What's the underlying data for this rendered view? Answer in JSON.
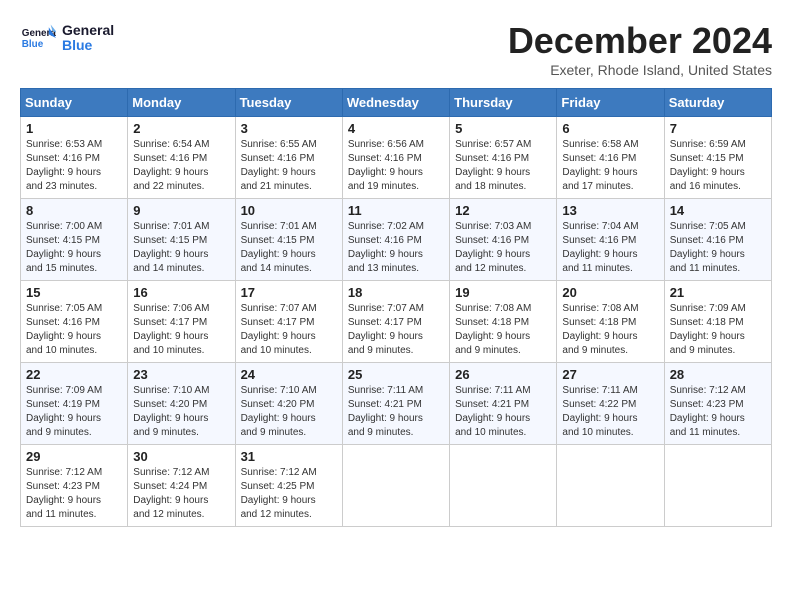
{
  "logo": {
    "line1": "General",
    "line2": "Blue"
  },
  "title": "December 2024",
  "location": "Exeter, Rhode Island, United States",
  "days_of_week": [
    "Sunday",
    "Monday",
    "Tuesday",
    "Wednesday",
    "Thursday",
    "Friday",
    "Saturday"
  ],
  "weeks": [
    [
      {
        "day": "1",
        "info": "Sunrise: 6:53 AM\nSunset: 4:16 PM\nDaylight: 9 hours\nand 23 minutes."
      },
      {
        "day": "2",
        "info": "Sunrise: 6:54 AM\nSunset: 4:16 PM\nDaylight: 9 hours\nand 22 minutes."
      },
      {
        "day": "3",
        "info": "Sunrise: 6:55 AM\nSunset: 4:16 PM\nDaylight: 9 hours\nand 21 minutes."
      },
      {
        "day": "4",
        "info": "Sunrise: 6:56 AM\nSunset: 4:16 PM\nDaylight: 9 hours\nand 19 minutes."
      },
      {
        "day": "5",
        "info": "Sunrise: 6:57 AM\nSunset: 4:16 PM\nDaylight: 9 hours\nand 18 minutes."
      },
      {
        "day": "6",
        "info": "Sunrise: 6:58 AM\nSunset: 4:16 PM\nDaylight: 9 hours\nand 17 minutes."
      },
      {
        "day": "7",
        "info": "Sunrise: 6:59 AM\nSunset: 4:15 PM\nDaylight: 9 hours\nand 16 minutes."
      }
    ],
    [
      {
        "day": "8",
        "info": "Sunrise: 7:00 AM\nSunset: 4:15 PM\nDaylight: 9 hours\nand 15 minutes."
      },
      {
        "day": "9",
        "info": "Sunrise: 7:01 AM\nSunset: 4:15 PM\nDaylight: 9 hours\nand 14 minutes."
      },
      {
        "day": "10",
        "info": "Sunrise: 7:01 AM\nSunset: 4:15 PM\nDaylight: 9 hours\nand 14 minutes."
      },
      {
        "day": "11",
        "info": "Sunrise: 7:02 AM\nSunset: 4:16 PM\nDaylight: 9 hours\nand 13 minutes."
      },
      {
        "day": "12",
        "info": "Sunrise: 7:03 AM\nSunset: 4:16 PM\nDaylight: 9 hours\nand 12 minutes."
      },
      {
        "day": "13",
        "info": "Sunrise: 7:04 AM\nSunset: 4:16 PM\nDaylight: 9 hours\nand 11 minutes."
      },
      {
        "day": "14",
        "info": "Sunrise: 7:05 AM\nSunset: 4:16 PM\nDaylight: 9 hours\nand 11 minutes."
      }
    ],
    [
      {
        "day": "15",
        "info": "Sunrise: 7:05 AM\nSunset: 4:16 PM\nDaylight: 9 hours\nand 10 minutes."
      },
      {
        "day": "16",
        "info": "Sunrise: 7:06 AM\nSunset: 4:17 PM\nDaylight: 9 hours\nand 10 minutes."
      },
      {
        "day": "17",
        "info": "Sunrise: 7:07 AM\nSunset: 4:17 PM\nDaylight: 9 hours\nand 10 minutes."
      },
      {
        "day": "18",
        "info": "Sunrise: 7:07 AM\nSunset: 4:17 PM\nDaylight: 9 hours\nand 9 minutes."
      },
      {
        "day": "19",
        "info": "Sunrise: 7:08 AM\nSunset: 4:18 PM\nDaylight: 9 hours\nand 9 minutes."
      },
      {
        "day": "20",
        "info": "Sunrise: 7:08 AM\nSunset: 4:18 PM\nDaylight: 9 hours\nand 9 minutes."
      },
      {
        "day": "21",
        "info": "Sunrise: 7:09 AM\nSunset: 4:18 PM\nDaylight: 9 hours\nand 9 minutes."
      }
    ],
    [
      {
        "day": "22",
        "info": "Sunrise: 7:09 AM\nSunset: 4:19 PM\nDaylight: 9 hours\nand 9 minutes."
      },
      {
        "day": "23",
        "info": "Sunrise: 7:10 AM\nSunset: 4:20 PM\nDaylight: 9 hours\nand 9 minutes."
      },
      {
        "day": "24",
        "info": "Sunrise: 7:10 AM\nSunset: 4:20 PM\nDaylight: 9 hours\nand 9 minutes."
      },
      {
        "day": "25",
        "info": "Sunrise: 7:11 AM\nSunset: 4:21 PM\nDaylight: 9 hours\nand 9 minutes."
      },
      {
        "day": "26",
        "info": "Sunrise: 7:11 AM\nSunset: 4:21 PM\nDaylight: 9 hours\nand 10 minutes."
      },
      {
        "day": "27",
        "info": "Sunrise: 7:11 AM\nSunset: 4:22 PM\nDaylight: 9 hours\nand 10 minutes."
      },
      {
        "day": "28",
        "info": "Sunrise: 7:12 AM\nSunset: 4:23 PM\nDaylight: 9 hours\nand 11 minutes."
      }
    ],
    [
      {
        "day": "29",
        "info": "Sunrise: 7:12 AM\nSunset: 4:23 PM\nDaylight: 9 hours\nand 11 minutes."
      },
      {
        "day": "30",
        "info": "Sunrise: 7:12 AM\nSunset: 4:24 PM\nDaylight: 9 hours\nand 12 minutes."
      },
      {
        "day": "31",
        "info": "Sunrise: 7:12 AM\nSunset: 4:25 PM\nDaylight: 9 hours\nand 12 minutes."
      },
      {
        "day": "",
        "info": ""
      },
      {
        "day": "",
        "info": ""
      },
      {
        "day": "",
        "info": ""
      },
      {
        "day": "",
        "info": ""
      }
    ]
  ]
}
